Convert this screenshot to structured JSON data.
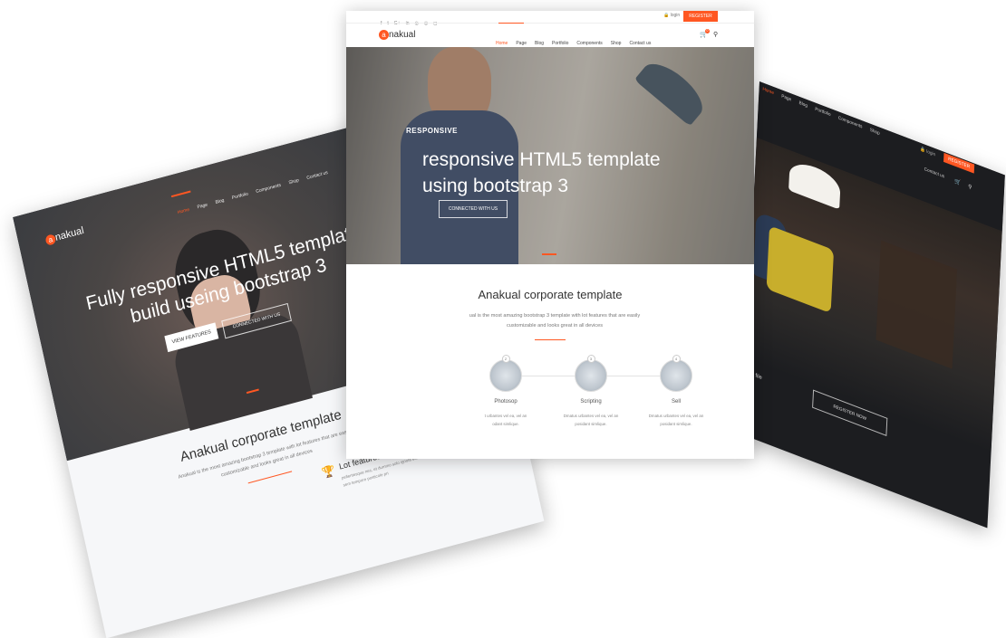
{
  "brand": {
    "name": "nakual",
    "logo_letter": "a",
    "accent": "#ff5722"
  },
  "nav": {
    "items": [
      "Home",
      "Page",
      "Blog",
      "Portfolio",
      "Components",
      "Shop",
      "Contact us"
    ],
    "login": "login",
    "register": "REGISTER",
    "cart_count": "0"
  },
  "center": {
    "hero_eyebrow": "RESPONSIVE",
    "hero_title_line1": "responsive HTML5 template",
    "hero_title_line2": "using bootstrap 3",
    "hero_button": "CONNECTED WITH US",
    "section_title": "Anakual corporate template",
    "section_desc_line1": "ual is the most amazing bootstrap 3 template with lot features that are easily",
    "section_desc_line2": "customizable and looks great in all devices",
    "features": [
      {
        "number": "2",
        "title": "Photosop",
        "desc_line1": "t urbantes vel ea, vel an",
        "desc_line2": "odant simlique."
      },
      {
        "number": "3",
        "title": "Scripting",
        "desc_line1": "Dmatus urbantes vel ea, vel an",
        "desc_line2": "posidant simlique."
      },
      {
        "number": "4",
        "title": "Sell",
        "desc_line1": "Dmatus urbantes vel ea, vel an",
        "desc_line2": "posidant simlique."
      }
    ]
  },
  "left": {
    "hero_title_line1": "Fully responsive HTML5 template",
    "hero_title_line2": "build useing bootstrap 3",
    "btn_features": "VIEW FEATURES",
    "btn_connect": "CONNECTED WITH US",
    "section_title": "Anakual corporate template",
    "section_desc_line1": "Anakual is the most amazing bootstrap 3 template with lot features that are easily",
    "section_desc_line2": "customizable and looks great in all devices",
    "feature_title": "Lot features",
    "feature_desc_line1": "pellentesque nec, et dummo solo ignola eu. Eu",
    "feature_desc_line2": "sem tempore posticole pri"
  },
  "right": {
    "fragment_text": "gn file",
    "register_now": "REGISTER NOW"
  }
}
